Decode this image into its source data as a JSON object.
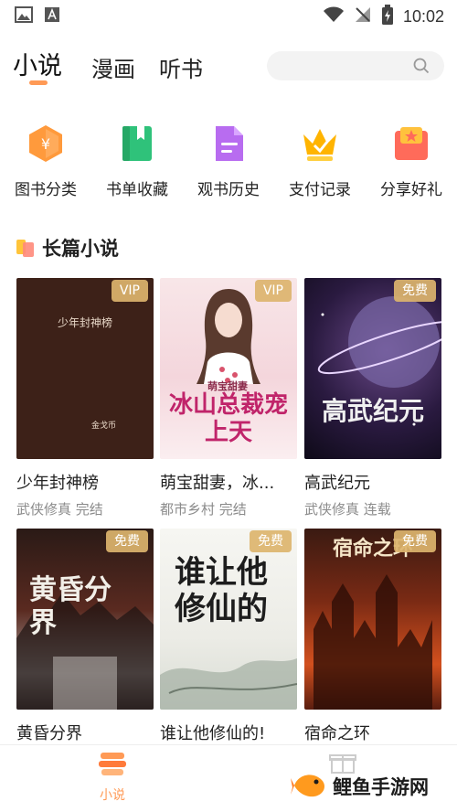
{
  "status_bar": {
    "time": "10:02"
  },
  "top_tabs": [
    {
      "label": "小说",
      "active": true
    },
    {
      "label": "漫画",
      "active": false
    },
    {
      "label": "听书",
      "active": false
    }
  ],
  "search": {
    "placeholder": ""
  },
  "categories": [
    {
      "label": "图书分类",
      "icon": "book-category-icon",
      "color": "#ff9a3c"
    },
    {
      "label": "书单收藏",
      "icon": "bookmark-book-icon",
      "color": "#2fc27a"
    },
    {
      "label": "观书历史",
      "icon": "document-history-icon",
      "color": "#b86cf0"
    },
    {
      "label": "支付记录",
      "icon": "crown-icon",
      "color": "#ffb400"
    },
    {
      "label": "分享好礼",
      "icon": "gift-icon",
      "color": "#ff6b5a"
    }
  ],
  "section": {
    "title": "长篇小说"
  },
  "books": [
    {
      "title": "少年封神榜",
      "meta": "武侠修真 完结",
      "badge": "VIP",
      "cover_title": "少年封神榜",
      "cover_author": "金戈币"
    },
    {
      "title": "萌宝甜妻，冰...",
      "meta": "都市乡村 完结",
      "badge": "VIP",
      "cover_title": "冰山总裁宠上天",
      "cover_subtitle": "萌宝甜妻"
    },
    {
      "title": "高武纪元",
      "meta": "武侠修真 连载",
      "badge": "免费",
      "cover_title": "高武纪元"
    },
    {
      "title": "黄昏分界",
      "meta": "",
      "badge": "免费",
      "cover_title": "黄昏分界"
    },
    {
      "title": "谁让他修仙的!",
      "meta": "",
      "badge": "免费",
      "cover_title": "谁让他修仙的"
    },
    {
      "title": "宿命之环",
      "meta": "",
      "badge": "免费",
      "cover_title": "宿命之环"
    }
  ],
  "bottom_nav": [
    {
      "label": "小说",
      "active": true
    },
    {
      "label": "",
      "active": false
    }
  ],
  "watermark": {
    "text": "鲤鱼手游网"
  },
  "colors": {
    "accent": "#ff9a56",
    "badge": "#dcb46e",
    "meta_text": "#8b8b8b"
  }
}
